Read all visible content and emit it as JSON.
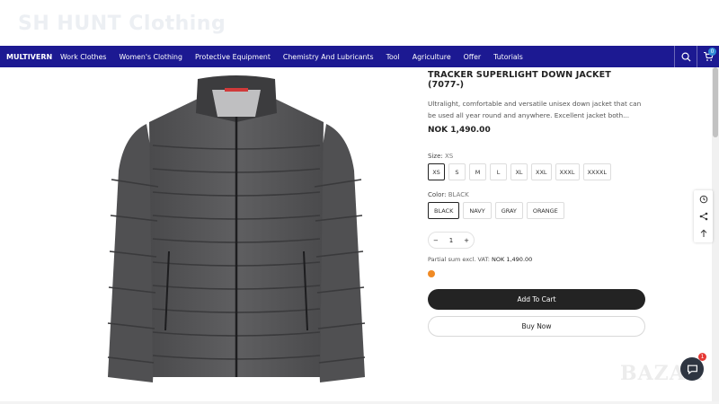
{
  "watermark": {
    "title": "SH HUNT Clothing"
  },
  "nav": {
    "brand": "MULTIVERN",
    "items": [
      "Work Clothes",
      "Women's Clothing",
      "Protective Equipment",
      "Chemistry And Lubricants",
      "Tool",
      "Agriculture",
      "Offer",
      "Tutorials"
    ],
    "cart_count": "0",
    "color": "#1c1992"
  },
  "product": {
    "title": "TRACKER SUPERLIGHT DOWN JACKET (7077-)",
    "description": "Ultralight, comfortable and versatile unisex down jacket that can be used all year round and anywhere. Excellent jacket both...",
    "price": "NOK 1,490.00",
    "size_label": "Size:",
    "size_selected": "XS",
    "sizes": [
      "XS",
      "S",
      "M",
      "L",
      "XL",
      "XXL",
      "XXXL",
      "XXXXL"
    ],
    "color_label": "Color:",
    "color_selected": "BLACK",
    "colors": [
      "BLACK",
      "NAVY",
      "GRAY",
      "ORANGE"
    ],
    "quantity": "1",
    "qty_minus": "−",
    "qty_plus": "+",
    "partial_label": "Partial sum excl. VAT:",
    "partial_value": "NOK 1,490.00",
    "add_to_cart": "Add To Cart",
    "buy_now": "Buy Now"
  },
  "tools": [
    "history-icon",
    "share-icon",
    "arrow-up-icon"
  ],
  "chat": {
    "badge": "1"
  }
}
